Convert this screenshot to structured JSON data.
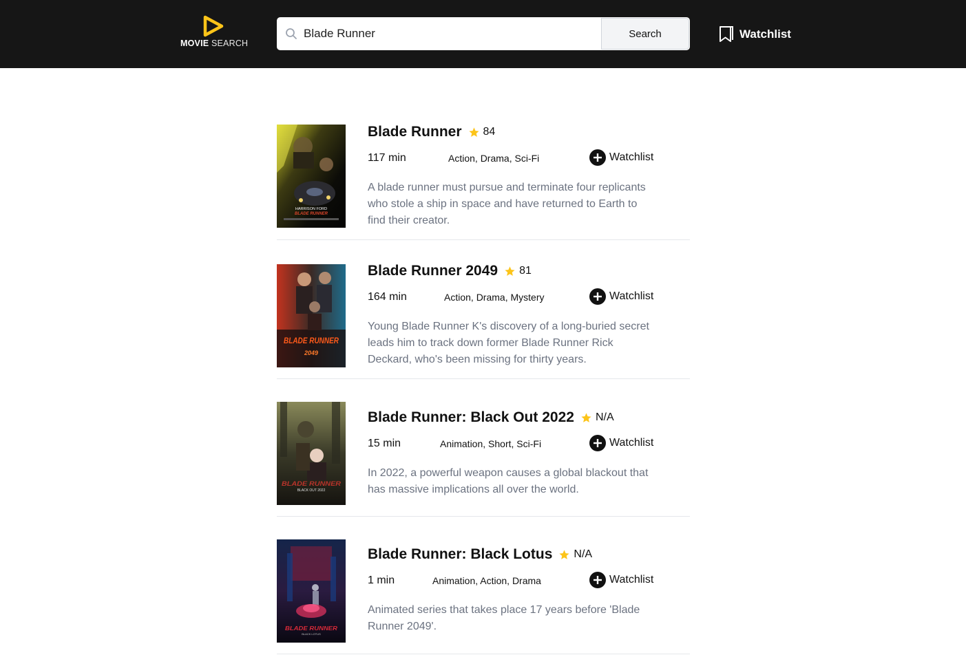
{
  "header": {
    "logo_bold": "MOVIE",
    "logo_light": "SEARCH",
    "search_value": "Blade Runner",
    "search_button": "Search",
    "watchlist_label": "Watchlist",
    "brand_color": "#FCC419"
  },
  "movies": [
    {
      "title": "Blade Runner",
      "rating": "84",
      "runtime": "117 min",
      "genres": "Action, Drama, Sci-Fi",
      "watchlist_label": "Watchlist",
      "plot": "A blade runner must pursue and terminate four replicants who stole a ship in space and have returned to Earth to find their creator.",
      "poster_caption": "HARRISON FORD",
      "poster_title": "BLADE RUNNER"
    },
    {
      "title": "Blade Runner 2049",
      "rating": "81",
      "runtime": "164 min",
      "genres": "Action, Drama, Mystery",
      "watchlist_label": "Watchlist",
      "plot": "Young Blade Runner K's discovery of a long-buried secret leads him to track down former Blade Runner Rick Deckard, who's been missing for thirty years.",
      "poster_title": "BLADE RUNNER",
      "poster_sub": "2049"
    },
    {
      "title": "Blade Runner: Black Out 2022",
      "rating": "N/A",
      "runtime": "15 min",
      "genres": "Animation, Short, Sci-Fi",
      "watchlist_label": "Watchlist",
      "plot": "In 2022, a powerful weapon causes a global blackout that has massive implications all over the world.",
      "poster_title": "BLADE RUNNER",
      "poster_sub": "BLACK OUT 2022"
    },
    {
      "title": "Blade Runner: Black Lotus",
      "rating": "N/A",
      "runtime": "1 min",
      "genres": "Animation, Action, Drama",
      "watchlist_label": "Watchlist",
      "plot": "Animated series that takes place 17 years before 'Blade Runner 2049'.",
      "poster_title": "BLADE RUNNER",
      "poster_sub": "BLACK LOTUS"
    }
  ]
}
